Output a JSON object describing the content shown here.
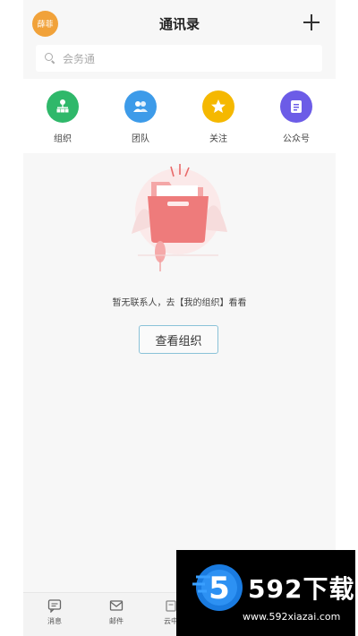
{
  "header": {
    "avatar_text": "薛菲",
    "title": "通讯录"
  },
  "search": {
    "placeholder": "会务通"
  },
  "shortcuts": [
    {
      "label": "组织",
      "color": "#2fb86a",
      "icon": "org-chart-icon"
    },
    {
      "label": "团队",
      "color": "#3d9be9",
      "icon": "team-icon"
    },
    {
      "label": "关注",
      "color": "#f5b800",
      "icon": "star-icon"
    },
    {
      "label": "公众号",
      "color": "#6c5ce7",
      "icon": "public-account-icon"
    }
  ],
  "empty_state": {
    "message": "暂无联系人，去【我的组织】看看",
    "button_label": "查看组织"
  },
  "tabbar": [
    {
      "label": "消息",
      "icon": "message-icon"
    },
    {
      "label": "邮件",
      "icon": "mail-icon"
    },
    {
      "label": "云中",
      "icon": "cloud-icon"
    }
  ],
  "watermark": {
    "brand": "592下载",
    "url": "www.592xiazai.com",
    "logo_digit": "5"
  },
  "colors": {
    "avatar": "#f1a23a",
    "button_border": "#8ac2d8",
    "folder": "#ee7b7b"
  }
}
